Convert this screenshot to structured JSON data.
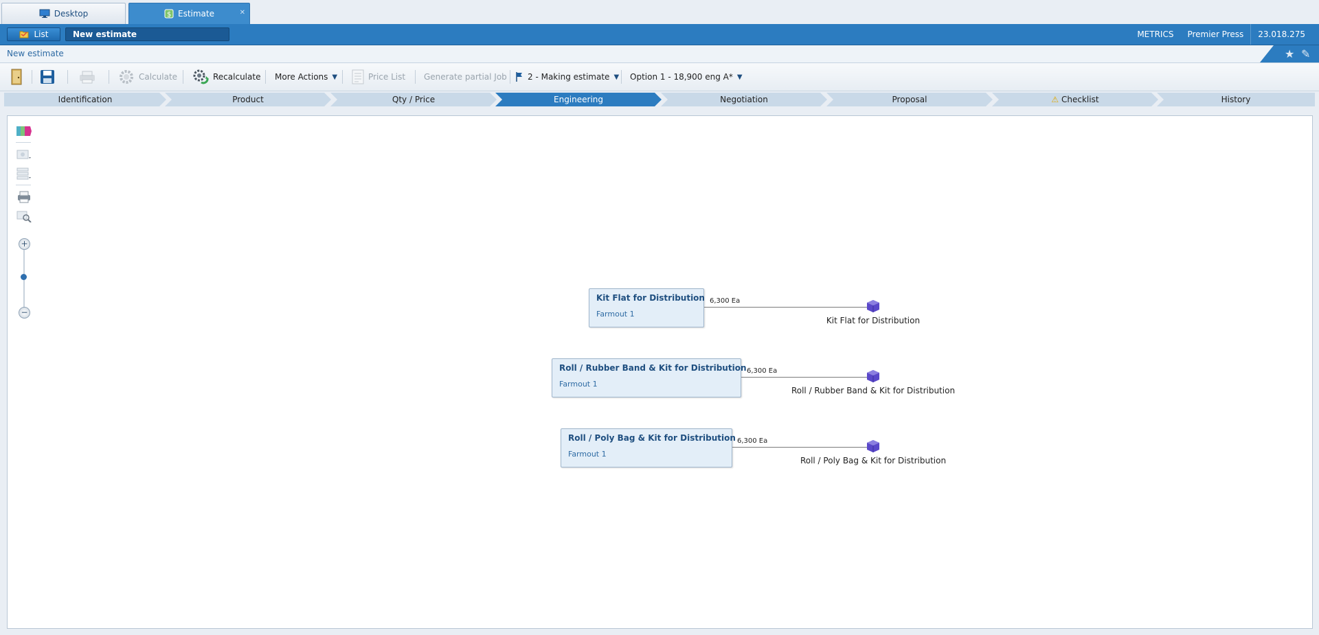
{
  "window_tabs": [
    {
      "label": "Desktop"
    },
    {
      "label": "Estimate"
    }
  ],
  "header": {
    "list_label": "List",
    "estimate_title": "New estimate",
    "right": [
      "METRICS",
      "Premier Press",
      "23.018.275"
    ]
  },
  "breadcrumb": "New estimate",
  "toolbar": {
    "calculate": "Calculate",
    "recalculate": "Recalculate",
    "more_actions": "More Actions",
    "price_list": "Price List",
    "generate_partial_job": "Generate partial Job",
    "status": "2 - Making estimate",
    "option": "Option 1 - 18,900 eng A*"
  },
  "steps": [
    "Identification",
    "Product",
    "Qty / Price",
    "Engineering",
    "Negotiation",
    "Proposal",
    "Checklist",
    "History"
  ],
  "active_step": "Engineering",
  "zoom_level": 0.5,
  "nodes": [
    {
      "title": "Kit Flat for Distribution",
      "sub": "Farmout 1",
      "qty": "6,300 Ea",
      "output": "Kit Flat for Distribution"
    },
    {
      "title": "Roll / Rubber Band & Kit for Distribution",
      "sub": "Farmout 1",
      "qty": "6,300 Ea",
      "output": "Roll / Rubber Band & Kit for Distribution"
    },
    {
      "title": "Roll / Poly Bag & Kit for Distribution",
      "sub": "Farmout 1",
      "qty": "6,300 Ea",
      "output": "Roll / Poly Bag & Kit for Distribution"
    }
  ],
  "colors": {
    "accent": "#2c7cc0",
    "step_inactive": "#c9d9e8",
    "node_bg": "#e3eef8"
  }
}
